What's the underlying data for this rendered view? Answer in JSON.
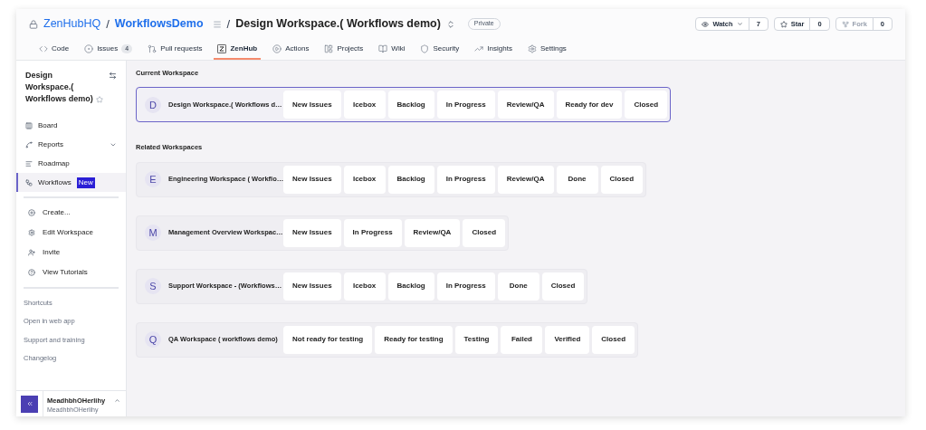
{
  "repo": {
    "owner": "ZenHubHQ",
    "name": "WorkflowsDemo",
    "title": "Design Workspace.( Workflows demo)",
    "visibility": "Private",
    "separator": "/"
  },
  "repo_actions": [
    {
      "kind": "watch",
      "label": "Watch",
      "count": "7"
    },
    {
      "kind": "star",
      "label": "Star",
      "count": "0"
    },
    {
      "kind": "fork",
      "label": "Fork",
      "count": "0",
      "disabled": true
    }
  ],
  "tabs": [
    {
      "kind": "code",
      "label": "Code",
      "selected": false
    },
    {
      "kind": "issues",
      "label": "Issues",
      "count": "4",
      "selected": false
    },
    {
      "kind": "pulls",
      "label": "Pull requests",
      "selected": false
    },
    {
      "kind": "zenhub",
      "label": "ZenHub",
      "selected": true
    },
    {
      "kind": "actions",
      "label": "Actions",
      "selected": false
    },
    {
      "kind": "projects",
      "label": "Projects",
      "selected": false
    },
    {
      "kind": "wiki",
      "label": "Wiki",
      "selected": false
    },
    {
      "kind": "security",
      "label": "Security",
      "selected": false
    },
    {
      "kind": "insights",
      "label": "Insights",
      "selected": false
    },
    {
      "kind": "settings",
      "label": "Settings",
      "selected": false
    }
  ],
  "sidebar": {
    "workspace_title": "Design Workspace.( Workflows demo)",
    "nav": [
      {
        "kind": "board",
        "label": "Board",
        "selected": false
      },
      {
        "kind": "reports",
        "label": "Reports",
        "expandable": true,
        "selected": false
      },
      {
        "kind": "roadmap",
        "label": "Roadmap",
        "selected": false
      },
      {
        "kind": "workflows",
        "label": "Workflows",
        "badge": "New",
        "selected": true
      }
    ],
    "actions": [
      {
        "kind": "create",
        "label": "Create..."
      },
      {
        "kind": "edit",
        "label": "Edit Workspace"
      },
      {
        "kind": "invite",
        "label": "Invite"
      },
      {
        "kind": "tutorials",
        "label": "View Tutorials"
      }
    ],
    "links": [
      "Shortcuts",
      "Open in web app",
      "Support and training",
      "Changelog"
    ],
    "user": {
      "name": "MeadhbhOHerlihy",
      "handle": "MeadhbhOHerlihy"
    }
  },
  "current_heading": "Current Workspace",
  "current": {
    "initial": "D",
    "name": "Design Workspace.( Workflows d…",
    "columns": [
      "New Issues",
      "Icebox",
      "Backlog",
      "In Progress",
      "Review/QA",
      "Ready for dev",
      "Closed"
    ]
  },
  "related_heading": "Related Workspaces",
  "related": [
    {
      "initial": "E",
      "name": "Engineering Workspace ( Workflo…",
      "columns": [
        "New Issues",
        "Icebox",
        "Backlog",
        "In Progress",
        "Review/QA",
        "Done",
        "Closed"
      ]
    },
    {
      "initial": "M",
      "name": "Management Overview Workspac…",
      "columns": [
        "New Issues",
        "In Progress",
        "Review/QA",
        "Closed"
      ]
    },
    {
      "initial": "S",
      "name": "Support Workspace - (Workflows…",
      "columns": [
        "New Issues",
        "Icebox",
        "Backlog",
        "In Progress",
        "Done",
        "Closed"
      ]
    },
    {
      "initial": "Q",
      "name": "QA Workspace ( workflows demo)",
      "columns": [
        "Not ready for testing",
        "Ready for testing",
        "Testing",
        "Failed",
        "Verified",
        "Closed"
      ]
    }
  ]
}
